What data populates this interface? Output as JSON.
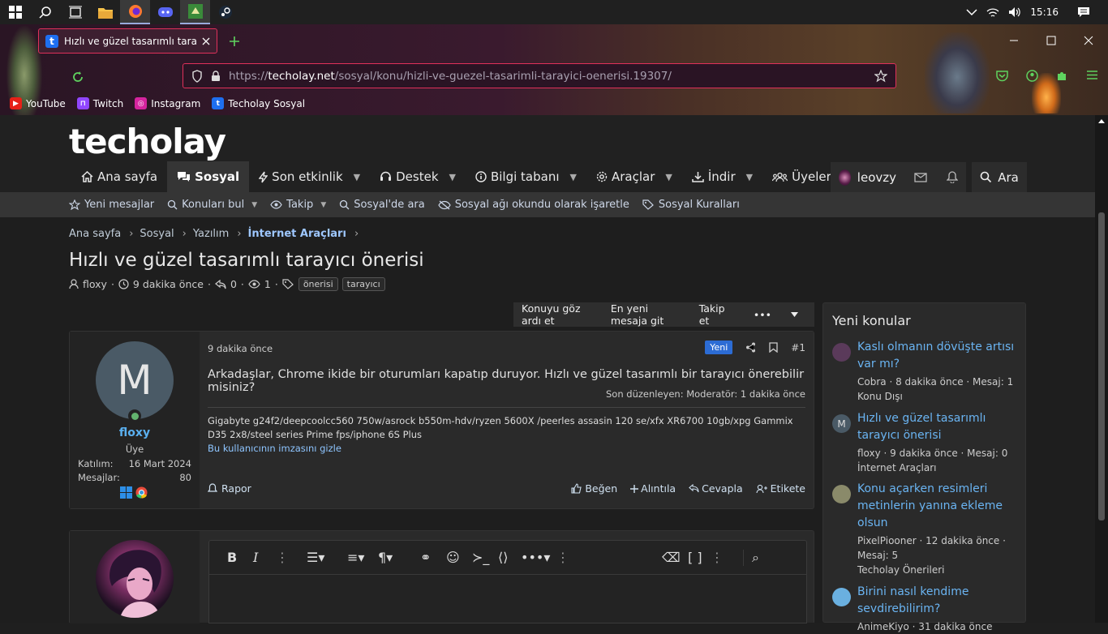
{
  "taskbar": {
    "time": "15:16"
  },
  "browser": {
    "tab_title": "Hızlı ve güzel tasarımlı tarayıcı ö",
    "tab_favicon": "t",
    "url_scheme": "https://",
    "url_host": "techolay.net",
    "url_path": "/sosyal/konu/hizli-ve-guezel-tasarimli-tarayici-oenerisi.19307/",
    "bookmarks": [
      {
        "label": "YouTube",
        "icon": "youtube-icon",
        "color": "#e62117",
        "glyph": "▶"
      },
      {
        "label": "Twitch",
        "icon": "twitch-icon",
        "color": "#9146ff",
        "glyph": "⊓"
      },
      {
        "label": "Instagram",
        "icon": "instagram-icon",
        "color": "#d6249f",
        "glyph": "◎"
      },
      {
        "label": "Techolay Sosyal",
        "icon": "techolay-icon",
        "color": "#1e6ff0",
        "glyph": "t"
      }
    ]
  },
  "site": {
    "logo": "techolay",
    "nav": [
      {
        "label": "Ana sayfa",
        "icon": "home-icon"
      },
      {
        "label": "Sosyal",
        "icon": "chat-icon",
        "active": true
      },
      {
        "label": "Son etkinlik",
        "icon": "bolt-icon",
        "dropdown": true
      },
      {
        "label": "Destek",
        "icon": "headset-icon",
        "dropdown": true
      },
      {
        "label": "Bilgi tabanı",
        "icon": "info-icon",
        "dropdown": true
      },
      {
        "label": "Araçlar",
        "icon": "gear-icon",
        "dropdown": true
      },
      {
        "label": "İndir",
        "icon": "download-icon",
        "dropdown": true
      },
      {
        "label": "Üyeler",
        "icon": "users-icon",
        "dropdown": true
      }
    ],
    "user": {
      "name": "leovzy"
    },
    "search_label": "Ara",
    "subnav": [
      {
        "label": "Yeni mesajlar",
        "icon": "star-icon"
      },
      {
        "label": "Konuları bul",
        "icon": "search-icon",
        "dropdown": true
      },
      {
        "label": "Takip",
        "icon": "eye-icon",
        "dropdown": true
      },
      {
        "label": "Sosyal'de ara",
        "icon": "search-icon"
      },
      {
        "label": "Sosyal ağı okundu olarak işaretle",
        "icon": "eye-slash-icon"
      },
      {
        "label": "Sosyal Kuralları",
        "icon": "tag-icon"
      }
    ],
    "breadcrumbs": [
      "Ana sayfa",
      "Sosyal",
      "Yazılım",
      "İnternet Araçları"
    ]
  },
  "thread": {
    "title": "Hızlı ve güzel tasarımlı tarayıcı önerisi",
    "author": "floxy",
    "time": "9 dakika önce",
    "replies": "0",
    "views": "1",
    "tags": [
      "önerisi",
      "tarayıcı"
    ],
    "actions": [
      "Konuyu göz ardı et",
      "En yeni mesaja git",
      "Takip et"
    ],
    "more_label": "•••"
  },
  "post": {
    "avatar_letter": "M",
    "username": "floxy",
    "role": "Üye",
    "joined_label": "Katılım:",
    "joined": "16 Mart 2024",
    "messages_label": "Mesajlar:",
    "messages": "80",
    "date": "9 dakika önce",
    "badge": "Yeni",
    "number": "#1",
    "text": "Arkadaşlar, Chrome ikide bir oturumları kapatıp duruyor. Hızlı ve güzel tasarımlı bir tarayıcı önerebilir misiniz?",
    "edited": "Son düzenleyen: Moderatör: 1 dakika önce",
    "signature": "Gigabyte g24f2/deepcoolcc560 750w/asrock b550m-hdv/ryzen 5600X /peerles assasin 120 se/xfx XR6700 10gb/xpg Gammix D35 2x8/steel series Prime fps/iphone 6S Plus",
    "hide_signature": "Bu kullanıcının imzasını gizle",
    "report": "Rapor",
    "like": "Beğen",
    "quote": "Alıntıla",
    "reply": "Cevapla",
    "tag_user": "Etikete"
  },
  "sidebar": {
    "title": "Yeni konular",
    "items": [
      {
        "title": "Kaslı olmanın dövüşte artısı var mı?",
        "meta": "Cobra · 8 dakika önce · Mesaj: 1",
        "forum": "Konu Dışı",
        "avatar_color": "#5a3a5a"
      },
      {
        "title": "Hızlı ve güzel tasarımlı tarayıcı önerisi",
        "meta": "floxy · 9 dakika önce · Mesaj: 0",
        "forum": "İnternet Araçları",
        "avatar_color": "#4a5a66",
        "avatar_letter": "M"
      },
      {
        "title": "Konu açarken resimleri metinlerin yanına ekleme olsun",
        "meta": "PixelPiooner · 12 dakika önce · Mesaj: 5",
        "forum": "Techolay Önerileri",
        "avatar_color": "#8a8a6a"
      },
      {
        "title": "Birini nasıl kendime sevdirebilirim?",
        "meta": "AnimeKiyo · 31 dakika önce",
        "forum": "",
        "avatar_color": "#6ab0e0"
      }
    ]
  }
}
